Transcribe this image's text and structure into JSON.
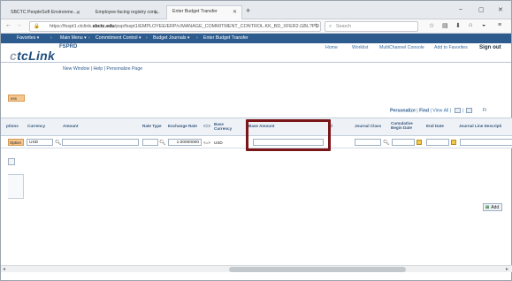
{
  "browser": {
    "tabs": [
      {
        "label": "SBCTC PeopleSoft Environme..."
      },
      {
        "label": "Employee-facing registry cont..."
      },
      {
        "label": "Enter Budget Transfer"
      }
    ],
    "url_prefix": "https://fsspt1.ctclink.",
    "url_domain": "sbctc.edu",
    "url_path": "/psp/fsspt1/EMPLOYEE/ERP/c/MANAGE_COMMITMENT_CONTROL.KK_BD_XFER2.GBL?PO",
    "search_placeholder": "Search"
  },
  "ps_nav": {
    "favorites": "Favorites ▾",
    "main_menu": "Main Menu ▾",
    "commitment_control": "Commitment Control ▾",
    "budget_journals": "Budget Journals ▾",
    "enter_budget_transfer": "Enter Budget Transfer"
  },
  "header": {
    "logo_prefix": "c",
    "logo_text": "tcLink",
    "environment": "FSPRD",
    "links": [
      "Home",
      "Worklist",
      "MultiChannel Console",
      "Add to Favorites"
    ],
    "sign_out": "Sign out"
  },
  "help_row": {
    "new_window": "New Window",
    "help": "Help",
    "personalize": "Personalize Page"
  },
  "orange_tab": "ess",
  "grid_toolbar": {
    "personalize": "Personalize",
    "find": "Find",
    "view_all": "View All",
    "suffix": "Fi"
  },
  "grid": {
    "headers": [
      "ptions",
      "Currency",
      "Amount",
      "Rate Type",
      "Exchange Rate",
      "<=>",
      "Base Currency",
      "Base Amount",
      "d",
      "Journal Class",
      "Cumulative Begin Date",
      "End Date",
      "Journal Line Descripti"
    ],
    "row": {
      "options": "Option",
      "currency": "USD",
      "amount": "",
      "rate_type": "",
      "exchange_rate": "1.00000000",
      "arrows": "<=>",
      "base_currency": "USD",
      "base_amount": "",
      "journal_class": "",
      "cumulative_begin_date": "",
      "end_date": "",
      "journal_line_description": ""
    }
  },
  "add_button": "Add",
  "colors": {
    "nav_blue": "#2d5b8e",
    "highlight_box": "#7a1518",
    "orange_button": "#f7c68f"
  }
}
